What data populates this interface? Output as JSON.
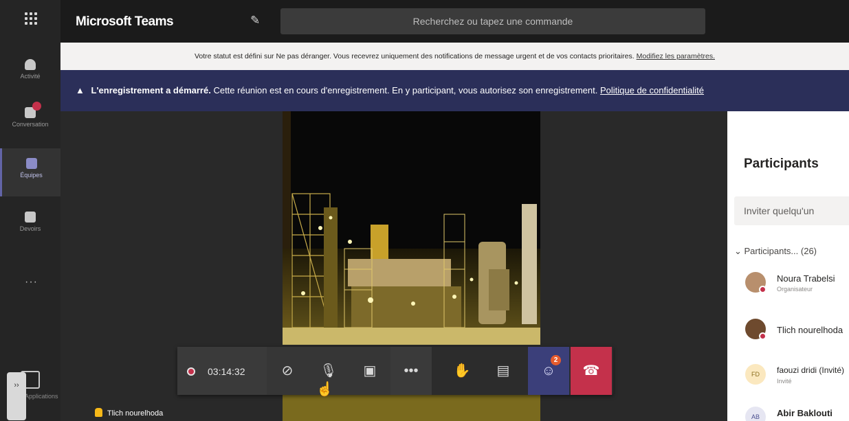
{
  "app": {
    "title": "Microsoft Teams"
  },
  "search": {
    "placeholder": "Recherchez ou tapez une commande"
  },
  "rail": {
    "items": [
      {
        "label": "Activité",
        "icon": "bell-icon"
      },
      {
        "label": "Conversation",
        "icon": "chat-icon"
      },
      {
        "label": "Équipes",
        "icon": "teams-icon"
      },
      {
        "label": "Devoirs",
        "icon": "assignments-icon"
      }
    ],
    "more": "···",
    "apps_label": "Applications",
    "expand_label": "››"
  },
  "status_banner": {
    "text": "Votre statut est défini sur Ne pas déranger. Vous recevrez uniquement des notifications de message urgent et de vos contacts prioritaires.",
    "link": "Modifiez les paramètres."
  },
  "recording_banner": {
    "title": "L'enregistrement a démarré.",
    "text": "Cette réunion est en cours d'enregistrement. En y participant, vous autorisez son enregistrement.",
    "link": "Politique de confidentialité"
  },
  "call": {
    "timer": "03:14:32",
    "people_badge": "2",
    "caller_name": "Tlich nourelhoda"
  },
  "participants": {
    "title": "Participants",
    "invite_placeholder": "Inviter quelqu'un",
    "section_label": "Participants... (26)",
    "list": [
      {
        "name": "Noura Trabelsi",
        "role": "Organisateur",
        "initials": ""
      },
      {
        "name": "Tlich nourelhoda",
        "role": "",
        "initials": ""
      },
      {
        "name": "faouzi dridi (Invité)",
        "role": "Invité",
        "initials": "FD"
      },
      {
        "name": "Abir Baklouti",
        "role": "",
        "initials": "AB"
      }
    ]
  },
  "colors": {
    "accent": "#6264a7",
    "recording_banner": "#2b2f59",
    "hangup": "#c4314b",
    "badge": "#e55b2d"
  }
}
